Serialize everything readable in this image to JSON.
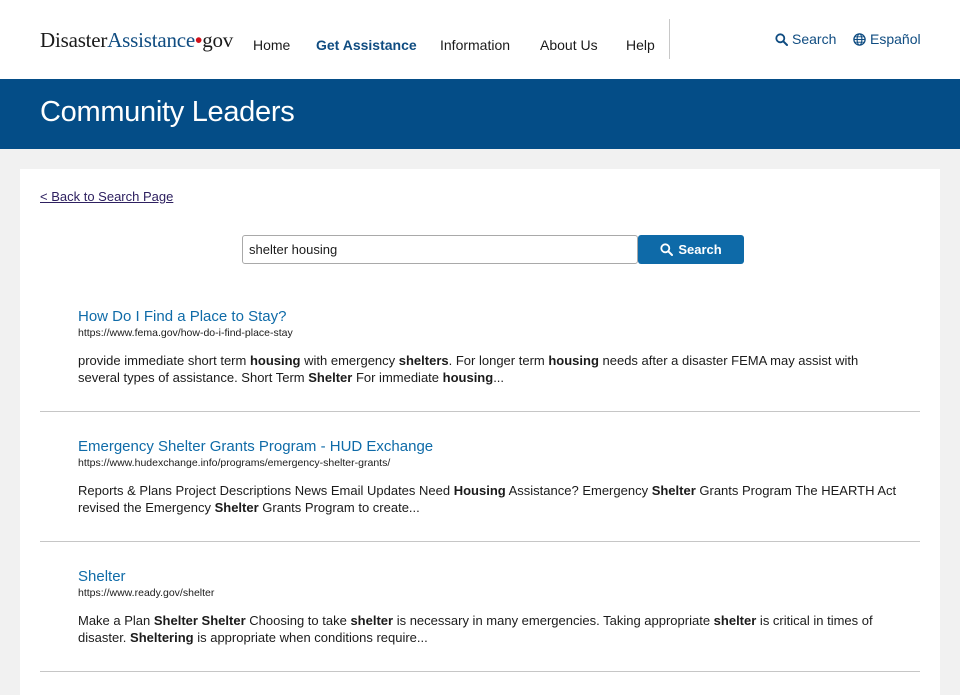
{
  "header": {
    "logo": {
      "part1": "Disaster",
      "part2": "Assistance",
      "dot": "•",
      "part3": "gov"
    },
    "nav": [
      {
        "label": "Home",
        "active": false
      },
      {
        "label": "Get Assistance",
        "active": true
      },
      {
        "label": "Information",
        "active": false
      },
      {
        "label": "About Us",
        "active": false
      },
      {
        "label": "Help",
        "active": false
      }
    ],
    "search_label": "Search",
    "language_label": "Español"
  },
  "banner": {
    "title": "Community Leaders"
  },
  "main": {
    "back_link": "< Back to Search Page",
    "search": {
      "value": "shelter housing",
      "button_label": "Search"
    },
    "results": [
      {
        "title": "How Do I Find a Place to Stay?",
        "url": "https://www.fema.gov/how-do-i-find-place-stay",
        "snippet": [
          {
            "t": "provide immediate short term ",
            "b": false
          },
          {
            "t": "housing",
            "b": true
          },
          {
            "t": " with emergency ",
            "b": false
          },
          {
            "t": "shelters",
            "b": true
          },
          {
            "t": ".  For longer term ",
            "b": false
          },
          {
            "t": "housing",
            "b": true
          },
          {
            "t": " needs after a disaster FEMA may assist with several types of assistance. Short Term ",
            "b": false
          },
          {
            "t": "Shelter",
            "b": true
          },
          {
            "t": " For immediate ",
            "b": false
          },
          {
            "t": "housing",
            "b": true
          },
          {
            "t": "...",
            "b": false
          }
        ]
      },
      {
        "title": "Emergency Shelter Grants Program - HUD Exchange",
        "url": "https://www.hudexchange.info/programs/emergency-shelter-grants/",
        "snippet": [
          {
            "t": "Reports & Plans Project Descriptions News Email Updates Need ",
            "b": false
          },
          {
            "t": "Housing",
            "b": true
          },
          {
            "t": " Assistance? Emergency ",
            "b": false
          },
          {
            "t": "Shelter",
            "b": true
          },
          {
            "t": " Grants Program The HEARTH Act  revised the Emergency ",
            "b": false
          },
          {
            "t": "Shelter",
            "b": true
          },
          {
            "t": " Grants Program to create...",
            "b": false
          }
        ]
      },
      {
        "title": "Shelter",
        "url": "https://www.ready.gov/shelter",
        "snippet": [
          {
            "t": "Make a Plan ",
            "b": false
          },
          {
            "t": "Shelter Shelter",
            "b": true
          },
          {
            "t": " Choosing to take ",
            "b": false
          },
          {
            "t": "shelter",
            "b": true
          },
          {
            "t": " is necessary in many emergencies. Taking appropriate ",
            "b": false
          },
          {
            "t": "shelter",
            "b": true
          },
          {
            "t": " is critical in times of disaster. ",
            "b": false
          },
          {
            "t": "Sheltering",
            "b": true
          },
          {
            "t": " is appropriate when conditions require...",
            "b": false
          }
        ]
      }
    ]
  },
  "colors": {
    "banner": "#044d87",
    "link": "#0f6ba8",
    "button": "#0e6aa8",
    "logo_dot": "#d0121b"
  }
}
